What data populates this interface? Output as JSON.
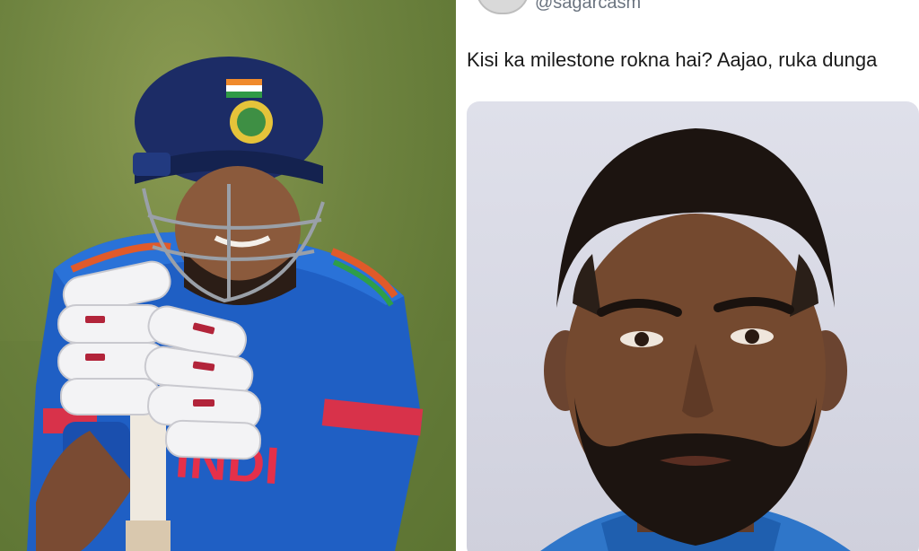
{
  "tweet": {
    "handle": "@sagarcasm",
    "text": "Kisi ka milestone rokna hai? Aajao, ruka dunga"
  },
  "left_photo": {
    "jersey_text": "INDI"
  }
}
